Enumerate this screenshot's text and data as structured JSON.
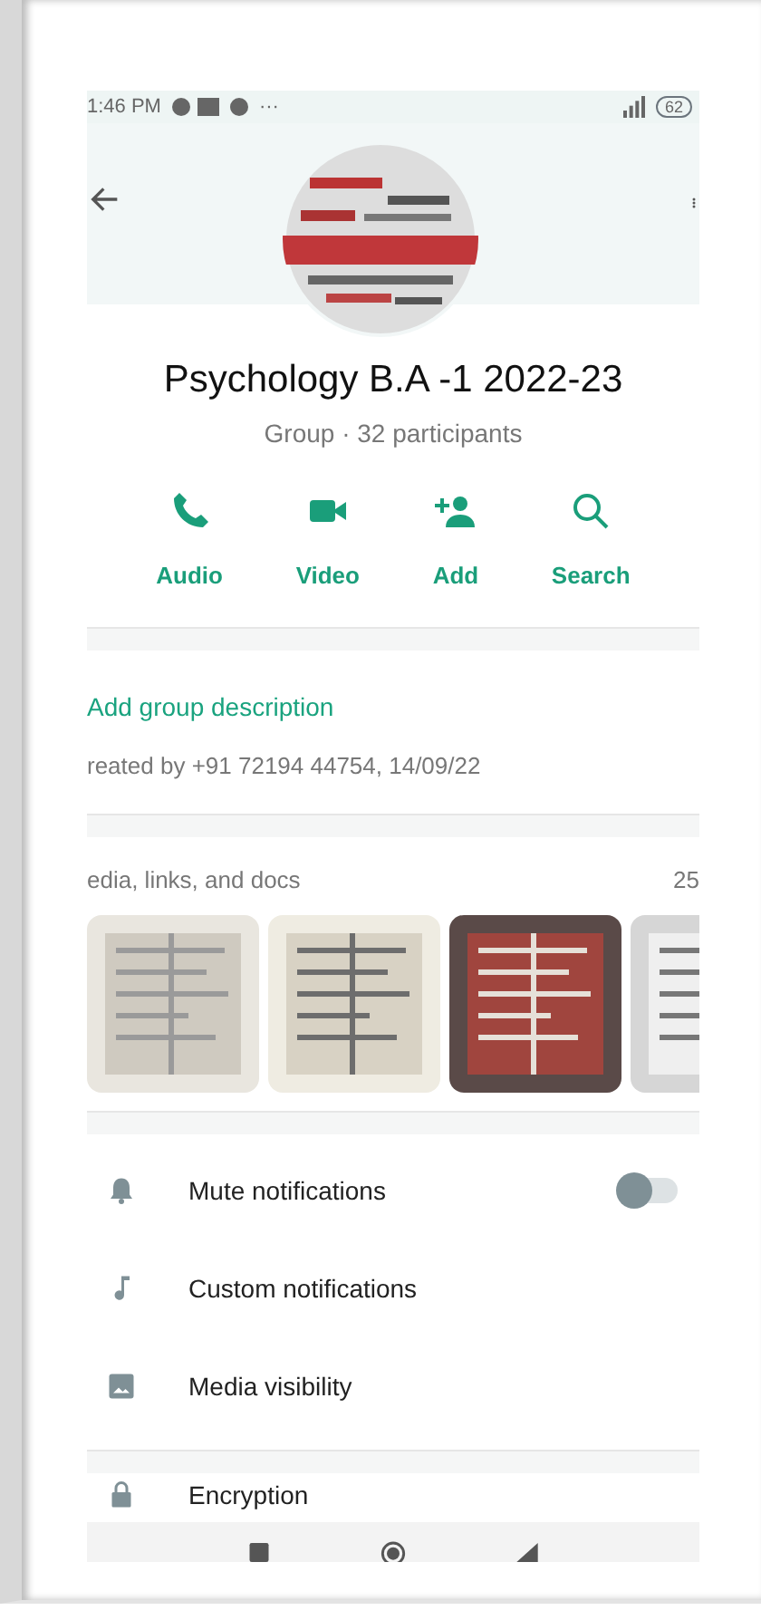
{
  "status_bar": {
    "time": "1:46 PM",
    "more": "···",
    "battery": "62"
  },
  "group": {
    "name": "Psychology B.A -1 2022-23",
    "subtitle": "Group · 32 participants"
  },
  "actions": [
    {
      "kind": "audio",
      "label": "Audio"
    },
    {
      "kind": "video",
      "label": "Video"
    },
    {
      "kind": "add",
      "label": "Add"
    },
    {
      "kind": "search",
      "label": "Search"
    }
  ],
  "description": {
    "link": "Add group description",
    "created": "reated by +91 72194 44754, 14/09/22"
  },
  "media": {
    "title": "edia, links, and docs",
    "count": "25"
  },
  "settings": [
    {
      "kind": "mute",
      "label": "Mute notifications",
      "on": false
    },
    {
      "kind": "custom",
      "label": "Custom notifications"
    },
    {
      "kind": "visibility",
      "label": "Media visibility"
    }
  ],
  "security": [
    {
      "kind": "encryption",
      "label": "Encryption"
    }
  ]
}
